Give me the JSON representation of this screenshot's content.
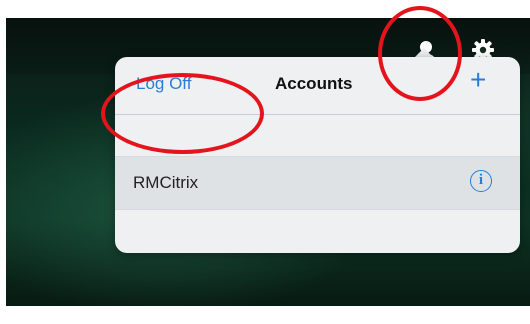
{
  "popover": {
    "logoff_label": "Log Off",
    "title": "Accounts",
    "add_label": "+",
    "accounts": [
      {
        "name": "RMCitrix",
        "info_label": "i"
      }
    ]
  },
  "icons": {
    "user": "user-icon",
    "settings": "gear-icon",
    "info": "info-icon"
  },
  "colors": {
    "accent": "#2a7dd6",
    "annotation": "#e3141b",
    "popover_bg": "#eef0f1",
    "selected_row_bg": "#dfe2e4"
  }
}
